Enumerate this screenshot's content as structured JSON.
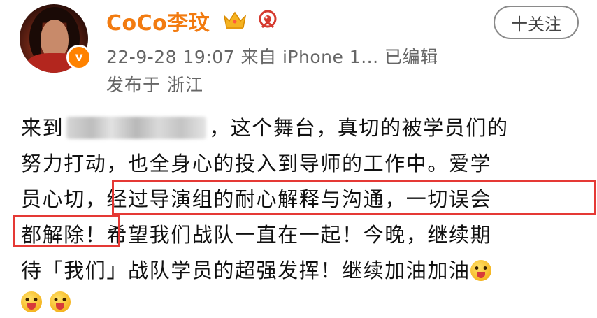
{
  "user": {
    "name": "CoCo李玟",
    "verified_mark": "v",
    "badges": [
      "crown-icon",
      "weibo-icon"
    ]
  },
  "post_meta": {
    "line1": "22-9-28 19:07  来自 iPhone 1...  已编辑",
    "line2": "发布于 浙江"
  },
  "follow_button": {
    "label": "十关注"
  },
  "post": {
    "line1_a": "来到",
    "line1_b": "，这个舞台，真切的被学员们的",
    "line2": "努力打动，也全身心的投入到导师的工作中。爱学",
    "line3_a": "员心切，",
    "line3_b": "经过导演组的耐心解释与沟通，一切误会",
    "line4_a": "都解除！",
    "line4_b": "希望我们战队一直在一起！今晚，继续期",
    "line5": "待「我们」战队学员的超强发挥！继续加油加油"
  },
  "colors": {
    "username": "#f27b10",
    "verify_badge": "#ff8200",
    "highlight_border": "#e53935",
    "meta_text": "#666666"
  }
}
